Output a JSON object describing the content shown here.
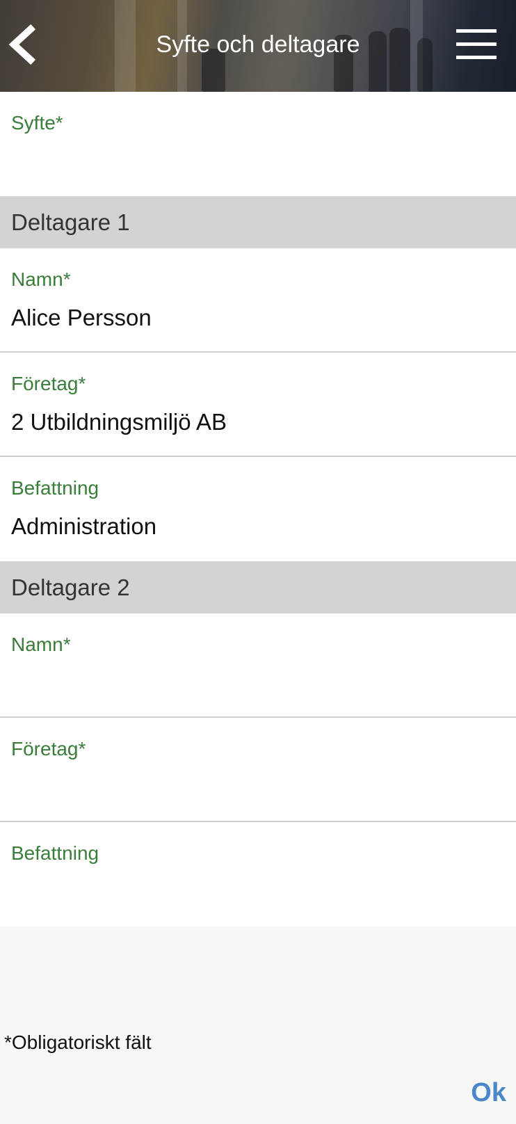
{
  "header": {
    "title": "Syfte och deltagare",
    "back_icon": "chevron-left-icon",
    "menu_icon": "hamburger-menu-icon"
  },
  "purpose": {
    "label": "Syfte*",
    "value": ""
  },
  "participants": [
    {
      "heading": "Deltagare 1",
      "name": {
        "label": "Namn*",
        "value": "Alice Persson"
      },
      "company": {
        "label": "Företag*",
        "value": "2 Utbildningsmiljö AB"
      },
      "position": {
        "label": "Befattning",
        "value": "Administration"
      }
    },
    {
      "heading": "Deltagare 2",
      "name": {
        "label": "Namn*",
        "value": ""
      },
      "company": {
        "label": "Företag*",
        "value": ""
      },
      "position": {
        "label": "Befattning",
        "value": ""
      }
    }
  ],
  "footer": {
    "required_note": "*Obligatoriskt fält",
    "ok_label": "Ok"
  },
  "colors": {
    "label_green": "#3a7d3a",
    "section_gray": "#d3d3d3",
    "ok_blue": "#4a86c8"
  }
}
